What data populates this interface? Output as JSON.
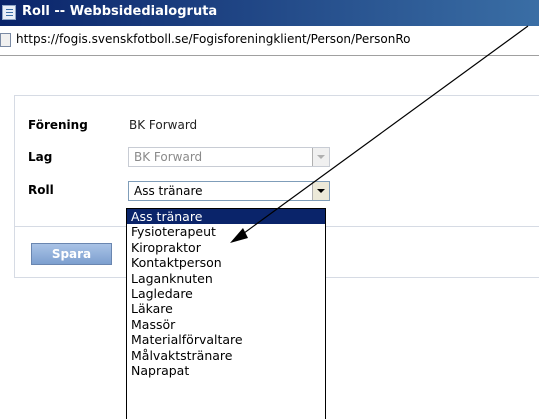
{
  "window": {
    "title": "Roll -- Webbsidedialogruta",
    "url": "https://fogis.svenskfotboll.se/Fogisforeningklient/Person/PersonRo"
  },
  "form": {
    "forening_label": "Förening",
    "forening_value": "BK Forward",
    "lag_label": "Lag",
    "lag_value": "BK Forward",
    "roll_label": "Roll",
    "roll_value": "Ass tränare",
    "save_label": "Spara"
  },
  "dropdown": {
    "options": [
      "Ass tränare",
      "Fysioterapeut",
      "Kiropraktor",
      "Kontaktperson",
      "Laganknuten",
      "Lagledare",
      "Läkare",
      "Massör",
      "Materialförvaltare",
      "Målvaktstränare",
      "Naprapat"
    ],
    "selected_index": 0
  },
  "colors": {
    "selection": "#0a246a",
    "save_button": "#7d9fcf",
    "titlebar": "#0a246a"
  }
}
